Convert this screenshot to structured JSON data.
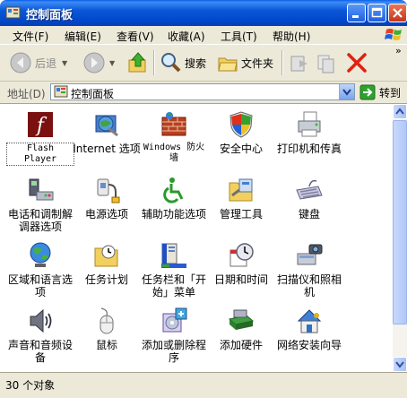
{
  "window": {
    "title": "控制面板"
  },
  "menu": [
    "文件(F)",
    "编辑(E)",
    "查看(V)",
    "收藏(A)",
    "工具(T)",
    "帮助(H)"
  ],
  "toolbar": {
    "back": "后退",
    "search": "搜索",
    "folders": "文件夹"
  },
  "address": {
    "label": "地址(D)",
    "value": "控制面板",
    "go": "转到"
  },
  "items": [
    {
      "label": "Flash Player",
      "icon": "flash-icon"
    },
    {
      "label": "Internet 选项",
      "icon": "internet-options-icon"
    },
    {
      "label": "Windows 防火墙",
      "icon": "firewall-icon"
    },
    {
      "label": "安全中心",
      "icon": "security-center-icon"
    },
    {
      "label": "打印机和传真",
      "icon": "printer-icon"
    },
    {
      "label": "电话和调制解调器选项",
      "icon": "phone-modem-icon"
    },
    {
      "label": "电源选项",
      "icon": "power-options-icon"
    },
    {
      "label": "辅助功能选项",
      "icon": "accessibility-icon"
    },
    {
      "label": "管理工具",
      "icon": "admin-tools-icon"
    },
    {
      "label": "键盘",
      "icon": "keyboard-icon"
    },
    {
      "label": "区域和语言选项",
      "icon": "globe-icon"
    },
    {
      "label": "任务计划",
      "icon": "scheduled-tasks-icon"
    },
    {
      "label": "任务栏和「开始」菜单",
      "icon": "taskbar-icon"
    },
    {
      "label": "日期和时间",
      "icon": "clock-icon"
    },
    {
      "label": "扫描仪和照相机",
      "icon": "scanner-icon"
    },
    {
      "label": "声音和音频设备",
      "icon": "sound-icon"
    },
    {
      "label": "鼠标",
      "icon": "mouse-icon"
    },
    {
      "label": "添加或删除程序",
      "icon": "add-remove-icon"
    },
    {
      "label": "添加硬件",
      "icon": "add-hardware-icon"
    },
    {
      "label": "网络安装向导",
      "icon": "network-setup-icon"
    }
  ],
  "status": {
    "text": "30 个对象"
  }
}
